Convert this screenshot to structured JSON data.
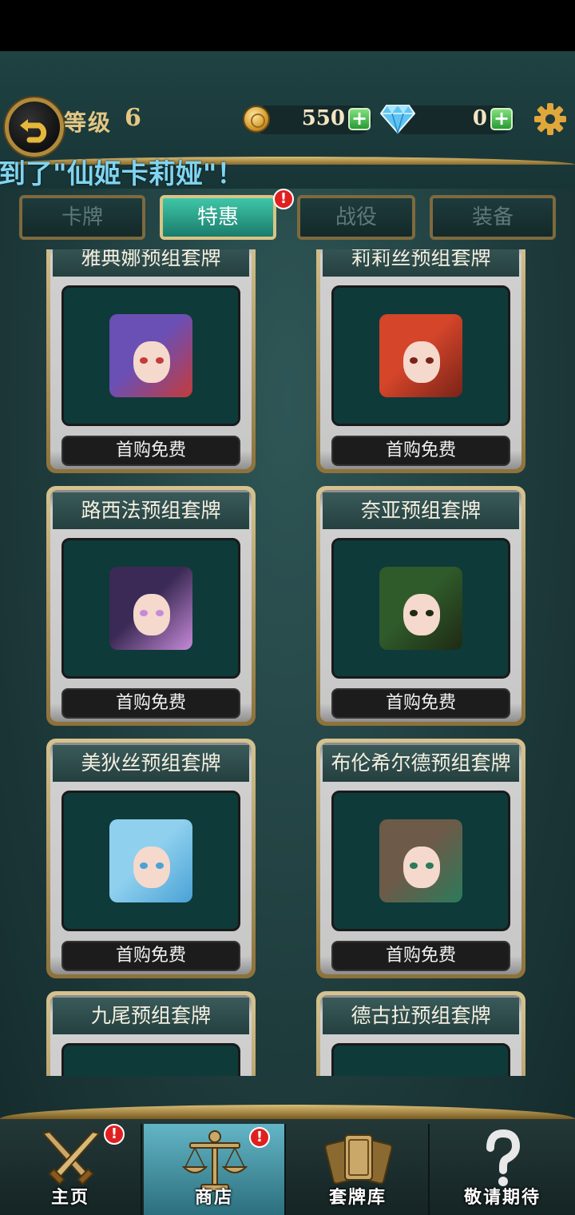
{
  "header": {
    "level_label": "等级",
    "level_value": "6",
    "gold": "550",
    "diamonds": "0",
    "plus_symbol": "+",
    "icons": [
      "back-icon",
      "gold-coin-icon",
      "diamond-icon",
      "gear-icon"
    ]
  },
  "marquee": {
    "text": "抽到了\"仙姬卡莉娅\"！"
  },
  "tabs": [
    {
      "label": "卡牌",
      "active": false
    },
    {
      "label": "特惠",
      "active": true,
      "badge": "!"
    },
    {
      "label": "战役",
      "active": false
    },
    {
      "label": "装备",
      "active": false
    }
  ],
  "decks": [
    {
      "title": "雅典娜预组套牌",
      "price": "首购免费",
      "hair": "#6a4fb5",
      "accent": "#c43b3b"
    },
    {
      "title": "莉莉丝预组套牌",
      "price": "首购免费",
      "hair": "#d4452a",
      "accent": "#7a2318"
    },
    {
      "title": "路西法预组套牌",
      "price": "首购免费",
      "hair": "#3b2a55",
      "accent": "#c68ad8"
    },
    {
      "title": "奈亚预组套牌",
      "price": "首购免费",
      "hair": "#2f5a2a",
      "accent": "#1e2a14"
    },
    {
      "title": "美狄丝预组套牌",
      "price": "首购免费",
      "hair": "#8fd0ee",
      "accent": "#4aa2d6"
    },
    {
      "title": "布伦希尔德预组套牌",
      "price": "首购免费",
      "hair": "#6d5a48",
      "accent": "#2c7a5a"
    },
    {
      "title": "九尾预组套牌",
      "price": "",
      "hair": "",
      "accent": ""
    },
    {
      "title": "德古拉预组套牌",
      "price": "",
      "hair": "",
      "accent": ""
    }
  ],
  "nav": [
    {
      "label": "主页",
      "icon": "crossed-swords-icon",
      "active": false,
      "badge": "!"
    },
    {
      "label": "商店",
      "icon": "balance-scale-icon",
      "active": true,
      "badge": "!"
    },
    {
      "label": "套牌库",
      "icon": "card-deck-icon",
      "active": false
    },
    {
      "label": "敬请期待",
      "icon": "question-mark-icon",
      "active": false
    }
  ]
}
